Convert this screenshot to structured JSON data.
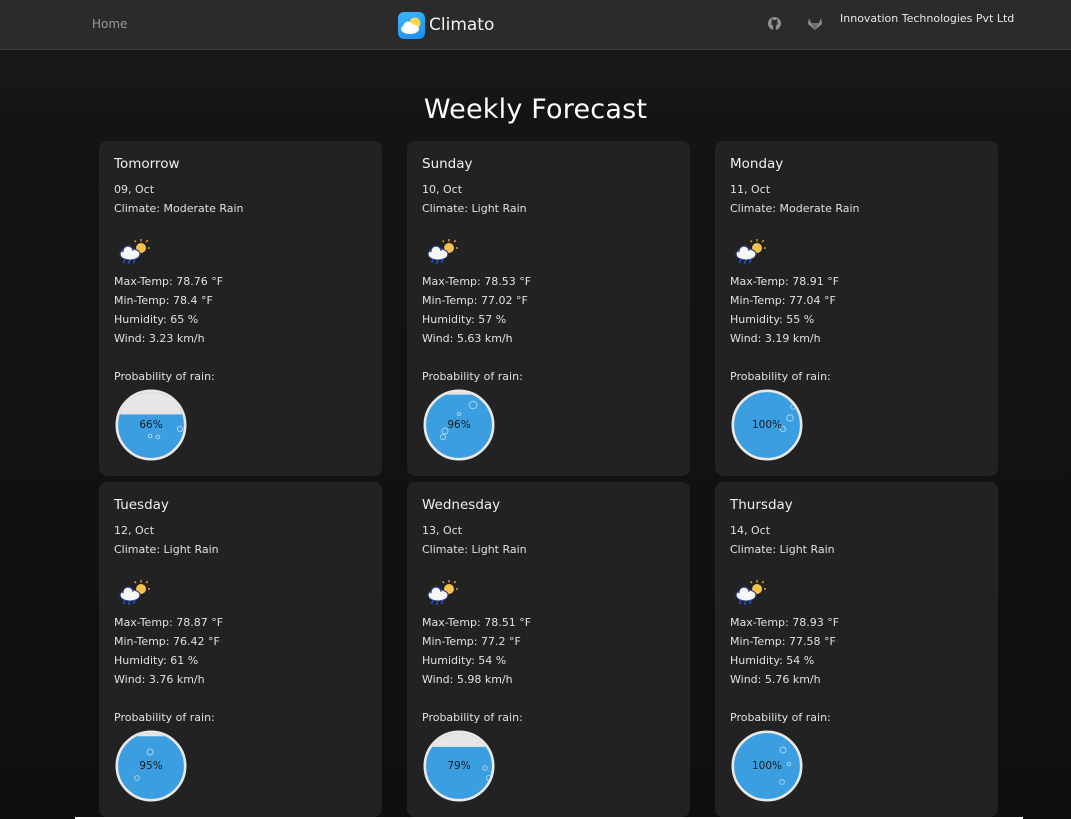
{
  "nav": {
    "home_label": "Home",
    "brand_name": "Climato",
    "company": "Innovation Technologies Pvt Ltd",
    "icons": [
      "github-icon",
      "gitlab-icon"
    ]
  },
  "page": {
    "title": "Weekly Forecast"
  },
  "labels": {
    "probability": "Probability of rain:"
  },
  "colors": {
    "water": "#3a9ee0",
    "empty": "#e6e6e6",
    "card": "#222223"
  },
  "forecast": [
    {
      "day": "Tomorrow",
      "date": "09, Oct",
      "climate": "Climate: Moderate Rain",
      "icon": "rain-cloud-sun-icon",
      "max": "Max-Temp: 78.76 °F",
      "min": "Min-Temp: 78.4 °F",
      "humidity": "Humidity: 65 %",
      "wind": "Wind: 3.23 km/h",
      "rain_pct": 66,
      "rain_text": "66%"
    },
    {
      "day": "Sunday",
      "date": "10, Oct",
      "climate": "Climate: Light Rain",
      "icon": "rain-cloud-sun-icon",
      "max": "Max-Temp: 78.53 °F",
      "min": "Min-Temp: 77.02 °F",
      "humidity": "Humidity: 57 %",
      "wind": "Wind: 5.63 km/h",
      "rain_pct": 96,
      "rain_text": "96%"
    },
    {
      "day": "Monday",
      "date": "11, Oct",
      "climate": "Climate: Moderate Rain",
      "icon": "rain-cloud-sun-icon",
      "max": "Max-Temp: 78.91 °F",
      "min": "Min-Temp: 77.04 °F",
      "humidity": "Humidity: 55 %",
      "wind": "Wind: 3.19 km/h",
      "rain_pct": 100,
      "rain_text": "100%"
    },
    {
      "day": "Tuesday",
      "date": "12, Oct",
      "climate": "Climate: Light Rain",
      "icon": "rain-cloud-sun-icon",
      "max": "Max-Temp: 78.87 °F",
      "min": "Min-Temp: 76.42 °F",
      "humidity": "Humidity: 61 %",
      "wind": "Wind: 3.76 km/h",
      "rain_pct": 95,
      "rain_text": "95%"
    },
    {
      "day": "Wednesday",
      "date": "13, Oct",
      "climate": "Climate: Light Rain",
      "icon": "rain-cloud-sun-icon",
      "max": "Max-Temp: 78.51 °F",
      "min": "Min-Temp: 77.2 °F",
      "humidity": "Humidity: 54 %",
      "wind": "Wind: 5.98 km/h",
      "rain_pct": 79,
      "rain_text": "79%"
    },
    {
      "day": "Thursday",
      "date": "14, Oct",
      "climate": "Climate: Light Rain",
      "icon": "rain-cloud-sun-icon",
      "max": "Max-Temp: 78.93 °F",
      "min": "Min-Temp: 77.58 °F",
      "humidity": "Humidity: 54 %",
      "wind": "Wind: 5.76 km/h",
      "rain_pct": 100,
      "rain_text": "100%"
    }
  ]
}
